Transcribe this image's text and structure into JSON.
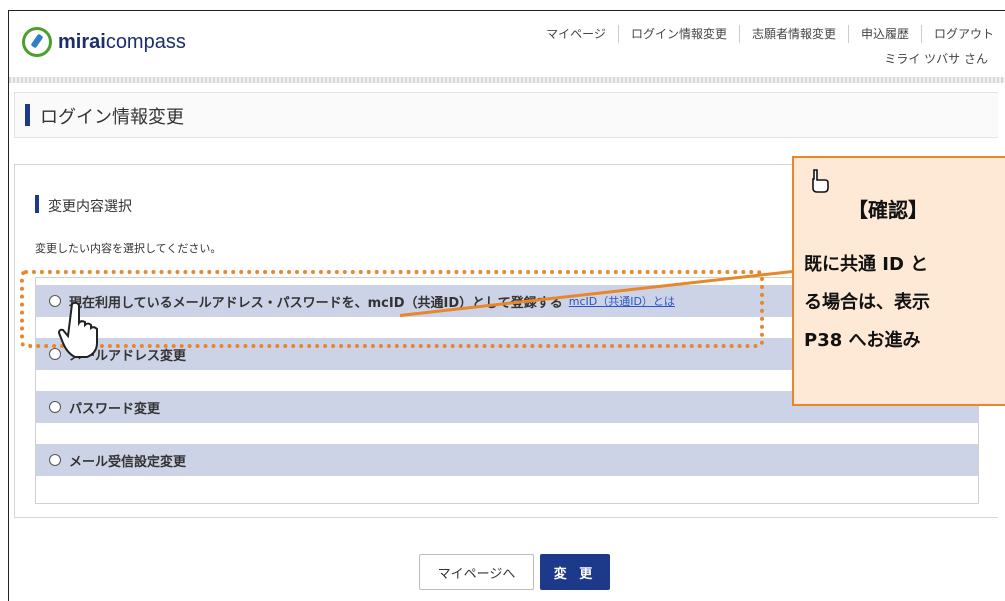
{
  "header": {
    "logo": {
      "bold": "mirai",
      "rest": "compass"
    },
    "nav": [
      "マイページ",
      "ログイン情報変更",
      "志願者情報変更",
      "申込履歴",
      "ログアウト"
    ],
    "user_name": "ミライ ツバサ さん"
  },
  "page": {
    "title": "ログイン情報変更",
    "section_title": "変更内容選択",
    "instruction": "変更したい内容を選択してください。"
  },
  "options": [
    {
      "label": "現在利用しているメールアドレス・パスワードを、mcID（共通ID）として登録する",
      "link": "mcID（共通ID）とは"
    },
    {
      "label": "メールアドレス変更"
    },
    {
      "label": "パスワード変更"
    },
    {
      "label": "メール受信設定変更"
    }
  ],
  "callout": {
    "title": "【確認】",
    "lines": [
      "既に共通 ID と",
      "る場合は、表示",
      "P38 へお進み"
    ]
  },
  "buttons": {
    "mypage": "マイページへ",
    "change": "変 更"
  },
  "colors": {
    "accent": "#1d3a8a",
    "callout_border": "#e8862a",
    "callout_bg": "#fde9d6",
    "option_bg": "#cdd3e6"
  }
}
